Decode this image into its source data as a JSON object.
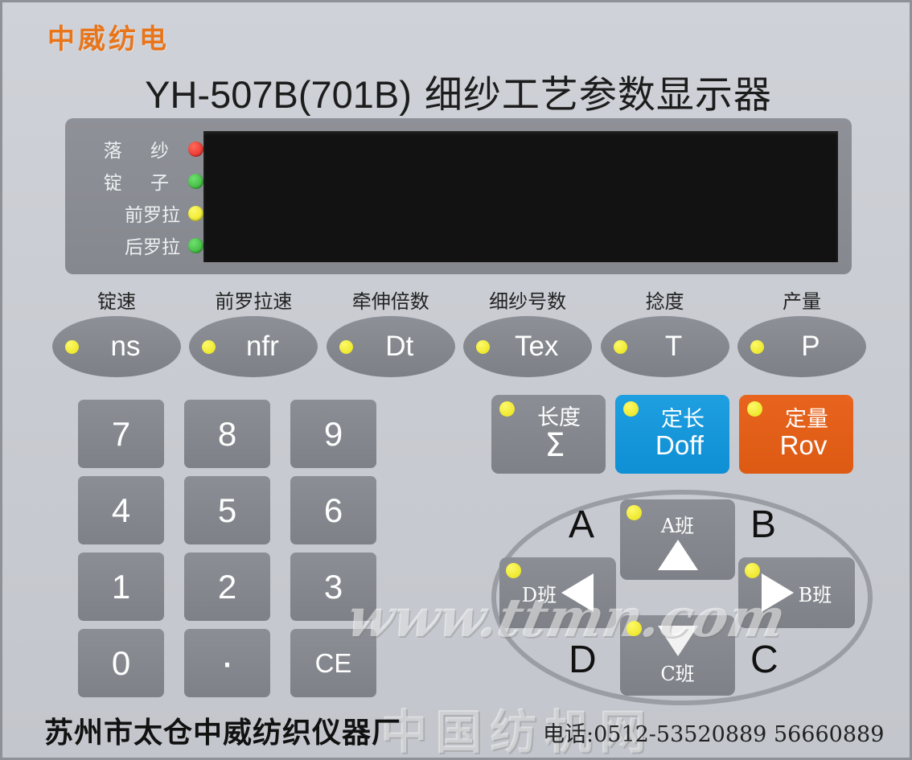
{
  "brand": "中威纺电",
  "title": {
    "model": "YH-507B(701B)",
    "cn": " 细纱工艺参数显示器"
  },
  "display": {
    "indicators": [
      {
        "label": "落  纱",
        "color": "#e02020",
        "name": "doffing"
      },
      {
        "label": "锭  子",
        "color": "#2eab2e",
        "name": "spindle"
      },
      {
        "label": "前罗拉",
        "color": "#ece41c",
        "name": "front-roller"
      },
      {
        "label": "后罗拉",
        "color": "#2eab2e",
        "name": "back-roller"
      }
    ],
    "lcd_value": ""
  },
  "function_buttons": [
    {
      "caption": "锭速",
      "code": "ns"
    },
    {
      "caption": "前罗拉速",
      "code": "nfr"
    },
    {
      "caption": "牵伸倍数",
      "code": "Dt"
    },
    {
      "caption": "细纱号数",
      "code": "Tex"
    },
    {
      "caption": "捻度",
      "code": "T"
    },
    {
      "caption": "产量",
      "code": "P"
    }
  ],
  "keypad": [
    "7",
    "8",
    "9",
    "4",
    "5",
    "6",
    "1",
    "2",
    "3",
    "0",
    "·",
    "CE"
  ],
  "mode_buttons": [
    {
      "cn": "长度",
      "en": "Σ",
      "color": "#8b8e94"
    },
    {
      "cn": "定长",
      "en": "Doff",
      "color": "#1e9fe0"
    },
    {
      "cn": "定量",
      "en": "Rov",
      "color": "#e8641e"
    }
  ],
  "dpad": {
    "corners": {
      "a": "A",
      "b": "B",
      "c": "C",
      "d": "D"
    },
    "up": "A班",
    "right": "B班",
    "down": "C班",
    "left": "D班"
  },
  "footer": {
    "company": "苏州市太仓中威纺织仪器厂",
    "phone": "电话:0512-53520889  56660889"
  },
  "watermark": {
    "line1": "www.ttmn.com",
    "line2": "中国纺机网"
  },
  "colors": {
    "panel_bg": "#c9ccd2",
    "button_gray": "#8b8e94",
    "accent_orange": "#e8751a",
    "accent_blue": "#1e9fe0",
    "led_yellow": "#ece41c",
    "lcd_black": "#121212"
  }
}
